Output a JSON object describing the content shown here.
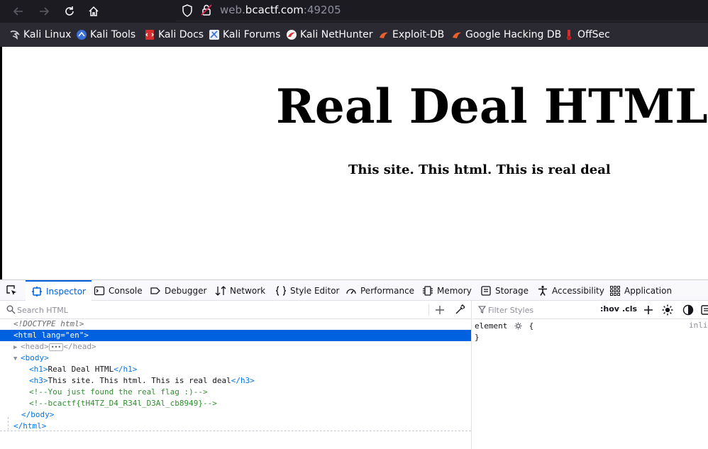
{
  "browser": {
    "url_prefix": "web.",
    "url_host": "bcactf.com",
    "url_suffix": ":49205",
    "bookmarks": [
      {
        "label": "Kali Linux",
        "icon": "kali-dragon-icon"
      },
      {
        "label": "Kali Tools",
        "icon": "kali-tools-icon"
      },
      {
        "label": "Kali Docs",
        "icon": "kali-docs-icon"
      },
      {
        "label": "Kali Forums",
        "icon": "kali-forums-icon"
      },
      {
        "label": "Kali NetHunter",
        "icon": "nethunter-icon"
      },
      {
        "label": "Exploit-DB",
        "icon": "exploit-db-icon"
      },
      {
        "label": "Google Hacking DB",
        "icon": "ghdb-icon"
      },
      {
        "label": "OffSec",
        "icon": "offsec-icon"
      }
    ]
  },
  "page": {
    "heading": "Real Deal HTML",
    "subheading": "This site. This html. This is real deal"
  },
  "devtools": {
    "tabs": [
      {
        "label": "Inspector",
        "icon": "inspector-icon"
      },
      {
        "label": "Console",
        "icon": "console-icon"
      },
      {
        "label": "Debugger",
        "icon": "debugger-icon"
      },
      {
        "label": "Network",
        "icon": "network-icon"
      },
      {
        "label": "Style Editor",
        "icon": "style-editor-icon"
      },
      {
        "label": "Performance",
        "icon": "performance-icon"
      },
      {
        "label": "Memory",
        "icon": "memory-icon"
      },
      {
        "label": "Storage",
        "icon": "storage-icon"
      },
      {
        "label": "Accessibility",
        "icon": "accessibility-icon"
      },
      {
        "label": "Application",
        "icon": "application-icon"
      }
    ],
    "search_placeholder": "Search HTML",
    "filter_placeholder": "Filter Styles",
    "hov_label": ":hov",
    "cls_label": ".cls",
    "rule_selector": "element",
    "rule_open": "{",
    "rule_close": "}",
    "inline_label": "inli",
    "tree": {
      "doctype": "<!DOCTYPE html>",
      "html_open": "<html",
      "lang_attr": "lang",
      "lang_val": "\"en\"",
      "html_close_bracket": ">",
      "head_open": "<head>",
      "head_close": "</head>",
      "body_open": "<body>",
      "h1_open": "<h1>",
      "h1_text": "Real Deal HTML",
      "h1_close": "</h1>",
      "h3_open": "<h3>",
      "h3_text": "This site. This html. This is real deal",
      "h3_close": "</h3>",
      "comment1": "<!--You just found the real flag :)-->",
      "comment2": "<!--bcactf{tH4TZ_D4_R34l_D3Al_cb8949}-->",
      "body_close": "</body>",
      "html_close": "</html>"
    }
  },
  "colors": {
    "chrome_bg": "#1c1b22",
    "bookmark_bg": "#2b2a33",
    "accent": "#0061e0"
  }
}
